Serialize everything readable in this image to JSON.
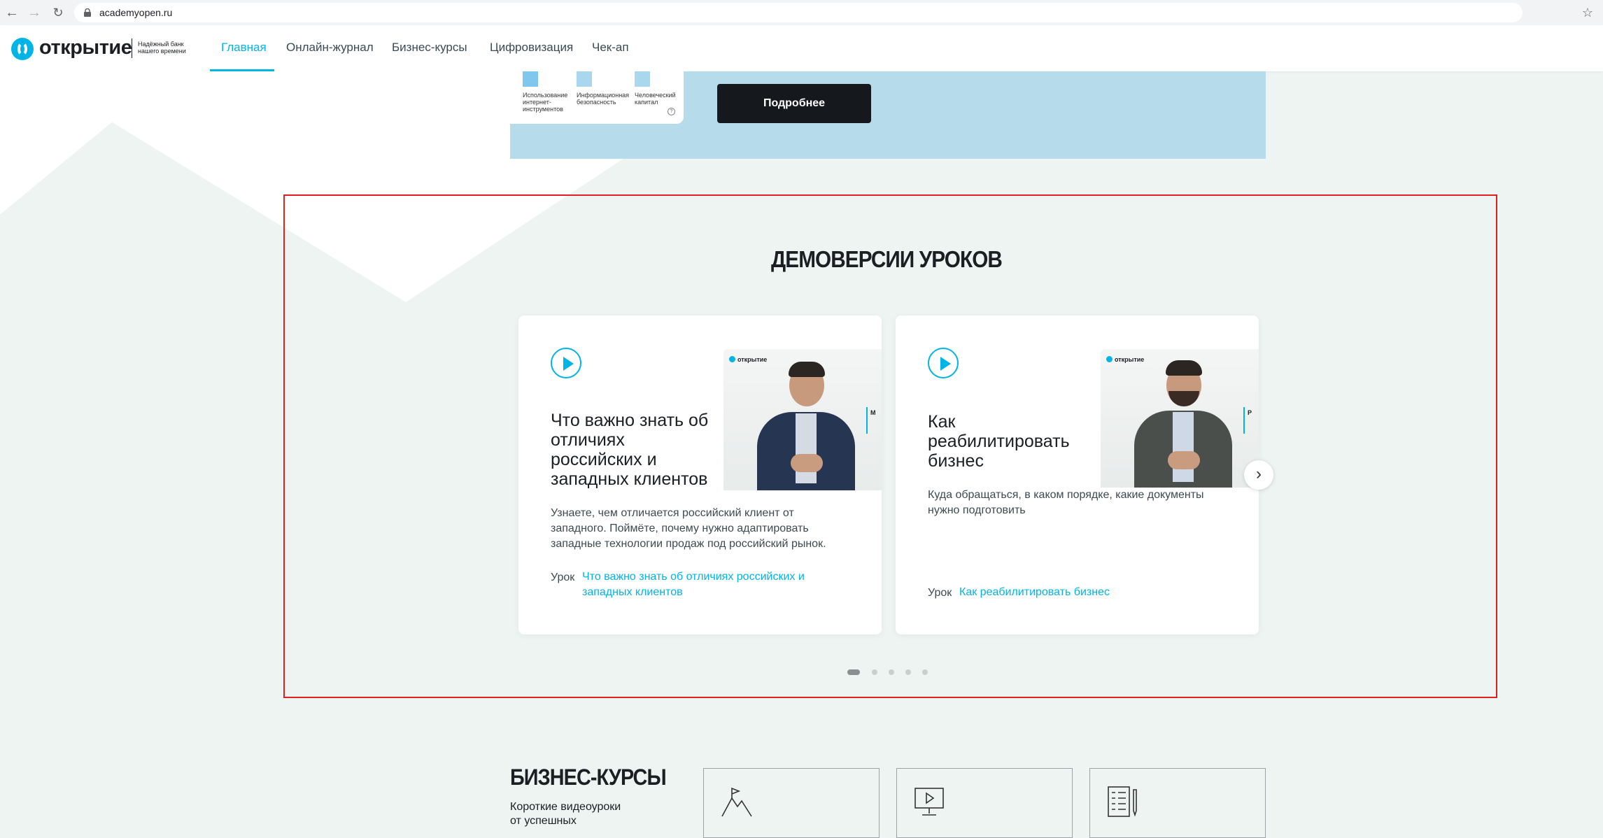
{
  "browser": {
    "url": "academyopen.ru"
  },
  "header": {
    "logo_text": "открытие",
    "logo_tagline_1": "Надёжный банк",
    "logo_tagline_2": "нашего времени",
    "nav": [
      {
        "label": "Главная",
        "active": true
      },
      {
        "label": "Онлайн-журнал"
      },
      {
        "label": "Бизнес-курсы"
      },
      {
        "label": "Цифровизация"
      },
      {
        "label": "Чек-ап"
      }
    ]
  },
  "banner": {
    "bars": [
      {
        "label": "Использование интернет-инструментов"
      },
      {
        "label": "Информационная безопасность"
      },
      {
        "label": "Человеческий капитал"
      }
    ],
    "button": "Подробнее"
  },
  "section": {
    "title": "ДЕМОВЕРСИИ УРОКОВ",
    "cards": [
      {
        "title_lines": [
          "Что важно знать об",
          "отличиях",
          "российских и",
          "западных клиентов"
        ],
        "desc_lines": [
          "Узнаете, чем отличается российский клиент от",
          "западного. Поймёте, почему нужно адаптировать",
          "западные технологии продаж под российский рынок."
        ],
        "lesson_label": "Урок",
        "lesson_link_lines": [
          "Что важно знать об отличиях российских и",
          "западных клиентов"
        ],
        "thumb_logo": "открытие",
        "thumb_text": "М"
      },
      {
        "title_lines": [
          "Как",
          "реабилитировать",
          "бизнес"
        ],
        "desc_lines": [
          "Куда обращаться, в каком порядке, какие документы",
          "нужно подготовить"
        ],
        "lesson_label": "Урок",
        "lesson_link_lines": [
          "Как реабилитировать бизнес"
        ],
        "thumb_logo": "открытие",
        "thumb_text": "Р"
      }
    ],
    "pagination": {
      "count": 5,
      "active": 1
    },
    "next_icon": "chevron-right-icon"
  },
  "business_courses": {
    "title": "БИЗНЕС-КУРСЫ",
    "desc_lines": [
      "Короткие видеоуроки",
      "от успешных"
    ],
    "icons": [
      "mountain-flag-icon",
      "monitor-play-icon",
      "checklist-pen-icon"
    ]
  },
  "colors": {
    "accent": "#00b4e6",
    "banner": "#b6dceb",
    "page_bg": "#edf4f1",
    "highlight": "#e02020"
  }
}
